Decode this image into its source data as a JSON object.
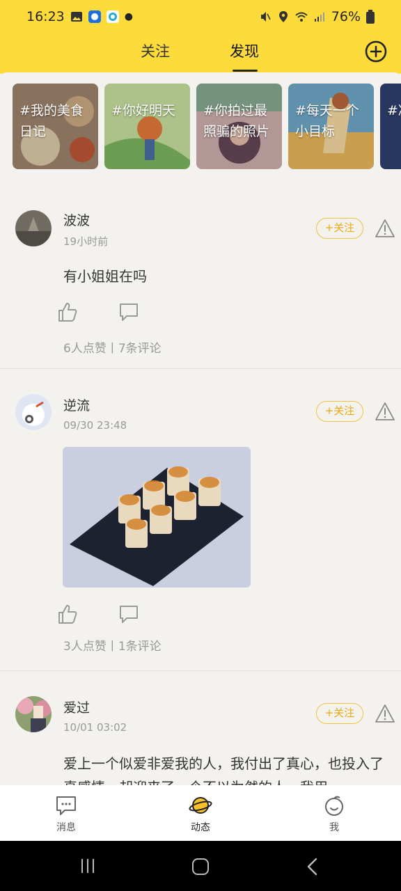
{
  "status": {
    "time": "16:23",
    "battery": "76%"
  },
  "tabs": [
    {
      "label": "关注"
    },
    {
      "label": "发现"
    }
  ],
  "topics": [
    {
      "label": "#我的美食日记"
    },
    {
      "label": "#你好明天"
    },
    {
      "label": "#你拍过最照骗的照片"
    },
    {
      "label": "#每天一个小目标"
    },
    {
      "label": "#减最"
    }
  ],
  "follow_label": "+关注",
  "posts": [
    {
      "name": "波波",
      "time": "19小时前",
      "text": "有小姐姐在吗",
      "stats": "6人点赞丨7条评论"
    },
    {
      "name": "逆流",
      "time": "09/30 23:48",
      "stats": "3人点赞丨1条评论"
    },
    {
      "name": "爱过",
      "time": "10/01 03:02",
      "text": "爱上一个似爱非爱我的人，我付出了真心，也投入了真感情，却迎来了一个不以为然的人，我用"
    }
  ],
  "nav": [
    {
      "label": "消息"
    },
    {
      "label": "动态"
    },
    {
      "label": "我"
    }
  ],
  "colors": {
    "accent": "#fddb3a",
    "follow": "#e8a90f"
  }
}
